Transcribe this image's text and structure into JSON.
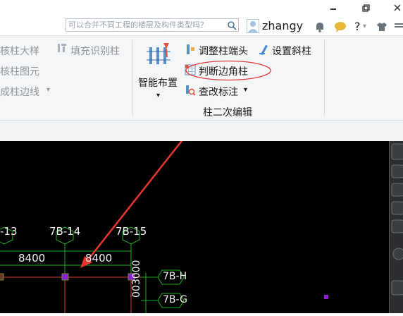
{
  "header": {
    "search_placeholder": "可以合并不同工程的楼层及构件类型吗？",
    "username": "zhangy"
  },
  "ribbon": {
    "left_items": [
      "核柱大样",
      "核柱图元",
      "成柱边线"
    ],
    "fill_identify_label": "填充识别柱",
    "smart_layout_label": "智能布置",
    "adjust_end_label": "调整柱端头",
    "set_slant_label": "设置斜柱",
    "judge_corner_label": "判断边角柱",
    "edit_annotation_label": "查改标注",
    "group_label": "柱二次编辑"
  },
  "drawing": {
    "axis_labels": [
      "-13",
      "7B-14",
      "7B-15"
    ],
    "dimensions": [
      "8400",
      "8400"
    ],
    "row_labels": [
      "7B-H",
      "7B-G"
    ],
    "vertical_dimension": "003000"
  },
  "colors": {
    "canvas_bg": "#000000",
    "annotation": "#ff3333",
    "grid_green": "#1db01d",
    "column_fill": "#8a1fd6"
  }
}
